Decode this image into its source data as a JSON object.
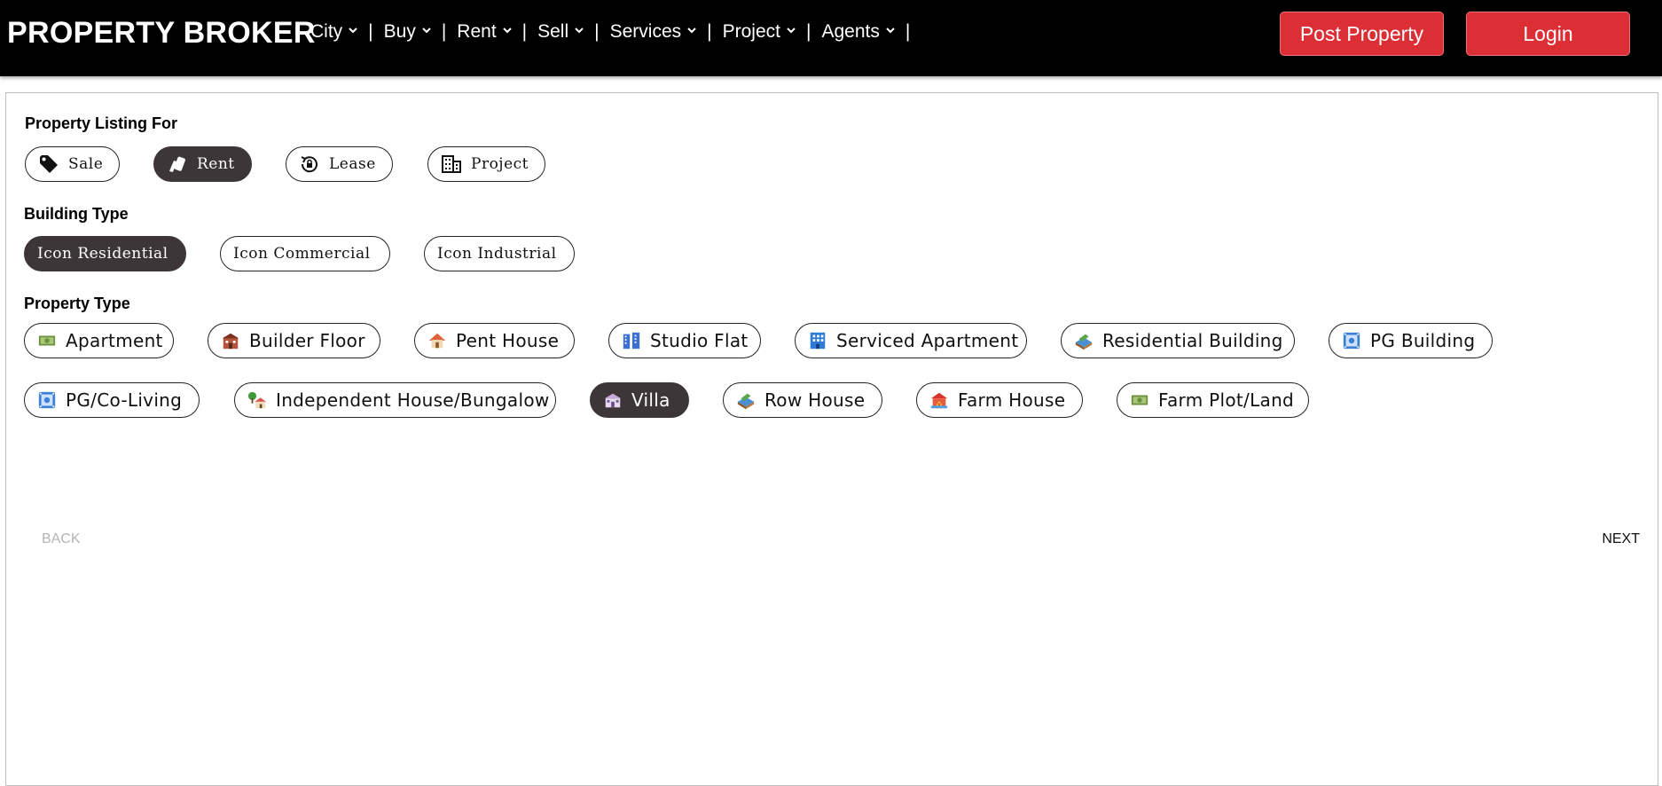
{
  "header": {
    "brand": "PROPERTY BROKER",
    "nav": [
      "City",
      "Buy",
      "Rent",
      "Sell",
      "Services",
      "Project",
      "Agents"
    ],
    "nav_separator": "|",
    "post_property": "Post Property",
    "login": "Login"
  },
  "listing_for": {
    "label": "Property Listing For",
    "options": [
      "Sale",
      "Rent",
      "Lease",
      "Project"
    ],
    "selected": "Rent"
  },
  "building_type": {
    "label": "Building Type",
    "options": [
      "Icon Residential",
      "Icon Commercial",
      "Icon Industrial"
    ],
    "selected": "Icon Residential"
  },
  "property_type": {
    "label": "Property Type",
    "options": [
      "Apartment",
      "Builder Floor",
      "Pent House",
      "Studio Flat",
      "Serviced Apartment",
      "Residential Building",
      "PG Building",
      "PG/Co-Living",
      "Independent House/Bungalow",
      "Villa",
      "Row House",
      "Farm House",
      "Farm Plot/Land"
    ],
    "selected": "Villa"
  },
  "footer": {
    "back": "BACK",
    "next": "NEXT"
  },
  "colors": {
    "header_bg": "#000000",
    "accent_red": "#dc2e35",
    "selected_pill": "#3d3638"
  }
}
